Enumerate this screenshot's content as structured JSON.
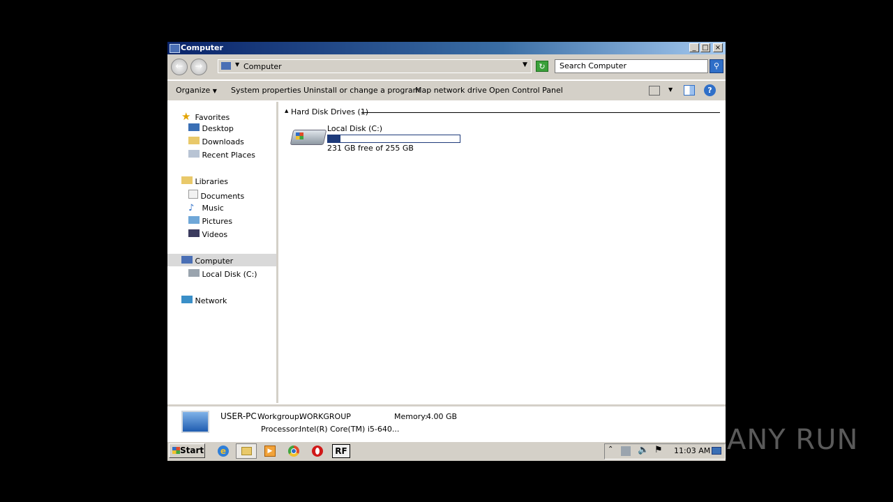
{
  "window": {
    "title": "Computer",
    "controls": [
      "_",
      "□",
      "×"
    ]
  },
  "address": {
    "path": "Computer",
    "search_placeholder": "Search Computer"
  },
  "toolbar": {
    "organize": "Organize",
    "system_properties": "System properties",
    "uninstall": "Uninstall or change a program",
    "map_drive": "Map network drive",
    "control_panel": "Open Control Panel"
  },
  "sidebar": {
    "favorites": "Favorites",
    "desktop": "Desktop",
    "downloads": "Downloads",
    "recent": "Recent Places",
    "libraries": "Libraries",
    "documents": "Documents",
    "music": "Music",
    "pictures": "Pictures",
    "videos": "Videos",
    "computer": "Computer",
    "local_disk": "Local Disk (C:)",
    "network": "Network"
  },
  "content": {
    "group_header": "Hard Disk Drives (1)",
    "drive_name": "Local Disk (C:)",
    "drive_free": "231 GB free of 255 GB",
    "drive_used_fraction": 0.094
  },
  "details": {
    "pc_name": "USER-PC",
    "workgroup_label": "Workgroup:",
    "workgroup": "WORKGROUP",
    "memory_label": "Memory:",
    "memory": "4.00 GB",
    "processor_label": "Processor:",
    "processor": "Intel(R) Core(TM) i5-640..."
  },
  "taskbar": {
    "start": "Start",
    "clock": "11:03 AM"
  },
  "watermark": "ANY RUN"
}
